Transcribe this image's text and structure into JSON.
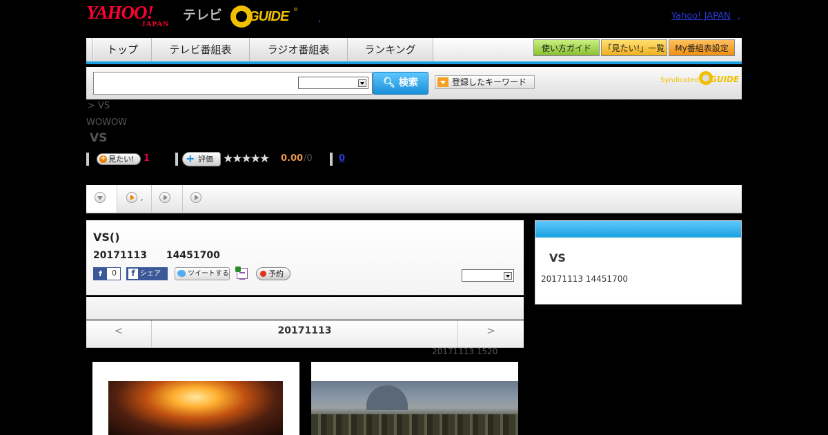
{
  "header": {
    "yahoo_logo_main": "YAHOO!",
    "yahoo_logo_sub": "JAPAN",
    "tv_label": "テレビ",
    "gguide_logo": "GUIDE",
    "gguide_reg": "®",
    "header_dot": ",",
    "yahoo_japan_link": "Yahoo! JAPAN",
    "yahoo_japan_dot": ","
  },
  "nav": {
    "tabs": [
      {
        "label": "トップ"
      },
      {
        "label": "テレビ番組表"
      },
      {
        "label": "ラジオ番組表"
      },
      {
        "label": "ランキング"
      }
    ],
    "buttons": [
      {
        "label": "使い方ガイド",
        "color": "#9ad040"
      },
      {
        "label": "「見たい!」一覧",
        "color": "#f5c030"
      },
      {
        "label": "My番組表設定",
        "color": "#f5a020"
      }
    ]
  },
  "search": {
    "input_value": "",
    "select_value": "",
    "button_label": "検索",
    "keyword_button_label": "登録したキーワード",
    "syndicated_label": "Syndicated",
    "syndicated_logo": "GUIDE"
  },
  "breadcrumb": ">  VS",
  "channel": "WOWOW",
  "program_heading": "VS",
  "ratings": {
    "mitai_label": "見たい!",
    "mitai_count": "1",
    "hyoka_label": "評価",
    "stars": "★★★★★",
    "rating_value": "0.00",
    "rating_count": "/0",
    "review_count": "0"
  },
  "subtabs": [
    {
      "label": ""
    },
    {
      "label": ","
    },
    {
      "label": ""
    },
    {
      "label": ""
    }
  ],
  "program": {
    "title": "VS()",
    "datetime": "20171113　　14451700",
    "fb_like_count": "0",
    "fb_share_label": "シェア",
    "tweet_label": "ツイートする",
    "reserve_label": "予約",
    "select_value": ""
  },
  "date_nav": {
    "prev": "<",
    "current": "20171113",
    "next": ">"
  },
  "updated_note": "20171113  1520",
  "side_panel": {
    "title": "VS",
    "datetime": "20171113  14451700"
  },
  "colors": {
    "accent_blue": "#1aa0e0",
    "yahoo_red": "#ff0033",
    "gguide_yellow": "#f0c000"
  }
}
